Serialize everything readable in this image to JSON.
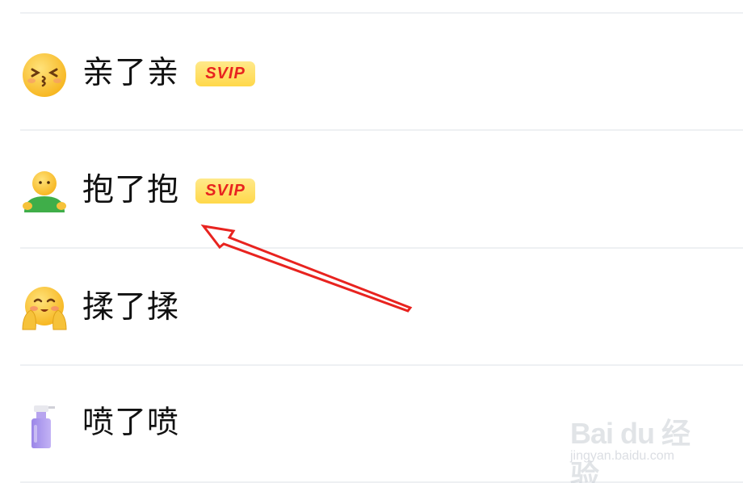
{
  "items": [
    {
      "label": "亲了亲",
      "icon": "kiss-face-icon",
      "badge": "SVIP"
    },
    {
      "label": "抱了抱",
      "icon": "hug-person-icon",
      "badge": "SVIP"
    },
    {
      "label": "揉了揉",
      "icon": "squeezed-cheeks-face-icon",
      "badge": ""
    },
    {
      "label": "喷了喷",
      "icon": "spray-bottle-icon",
      "badge": ""
    }
  ],
  "colors": {
    "badge_bg": "#ffd84a",
    "badge_text": "#e8231f",
    "arrow": "#e8231f",
    "divider": "#eef0f3"
  },
  "watermark": {
    "main": "Bai du 经验",
    "sub": "jingyan.baidu.com"
  }
}
